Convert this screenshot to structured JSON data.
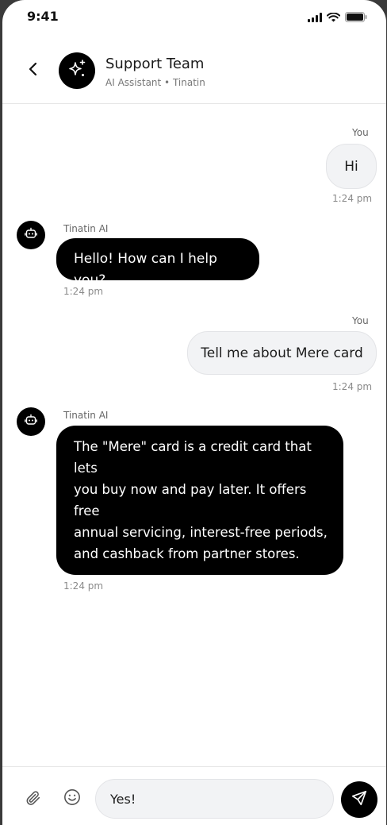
{
  "status_bar": {
    "time": "9:41",
    "icons": [
      "signal-icon",
      "wifi-icon",
      "battery-icon"
    ]
  },
  "header": {
    "back_icon": "chevron-left-icon",
    "avatar_icon": "sparkles-icon",
    "title": "Support Team",
    "subtitle": "AI Assistant • Tinatin"
  },
  "messages": [
    {
      "sender": "You",
      "text": "Hi",
      "time": "1:24 pm",
      "from": "user"
    },
    {
      "sender": "Tinatin AI",
      "text": "Hello! How can I help you?",
      "time": "1:24 pm",
      "from": "bot",
      "avatar_icon": "robot-icon"
    },
    {
      "sender": "You",
      "text": "Tell me about Mere card",
      "time": "1:24 pm",
      "from": "user"
    },
    {
      "sender": "Tinatin AI",
      "text": "The \"Mere\" card is a credit card that lets\nyou buy now and pay later. It offers free\nannual servicing, interest-free periods,\nand cashback from partner stores.\n\nWould you like to know more details?",
      "time": "1:24 pm",
      "from": "bot",
      "avatar_icon": "robot-icon"
    }
  ],
  "composer": {
    "attach_icon": "paperclip-icon",
    "emoji_icon": "smiley-icon",
    "input_value": "Yes!",
    "send_icon": "send-icon"
  },
  "colors": {
    "bot_bubble": "#000000",
    "user_bubble": "#f2f3f5",
    "accent": "#000000"
  }
}
